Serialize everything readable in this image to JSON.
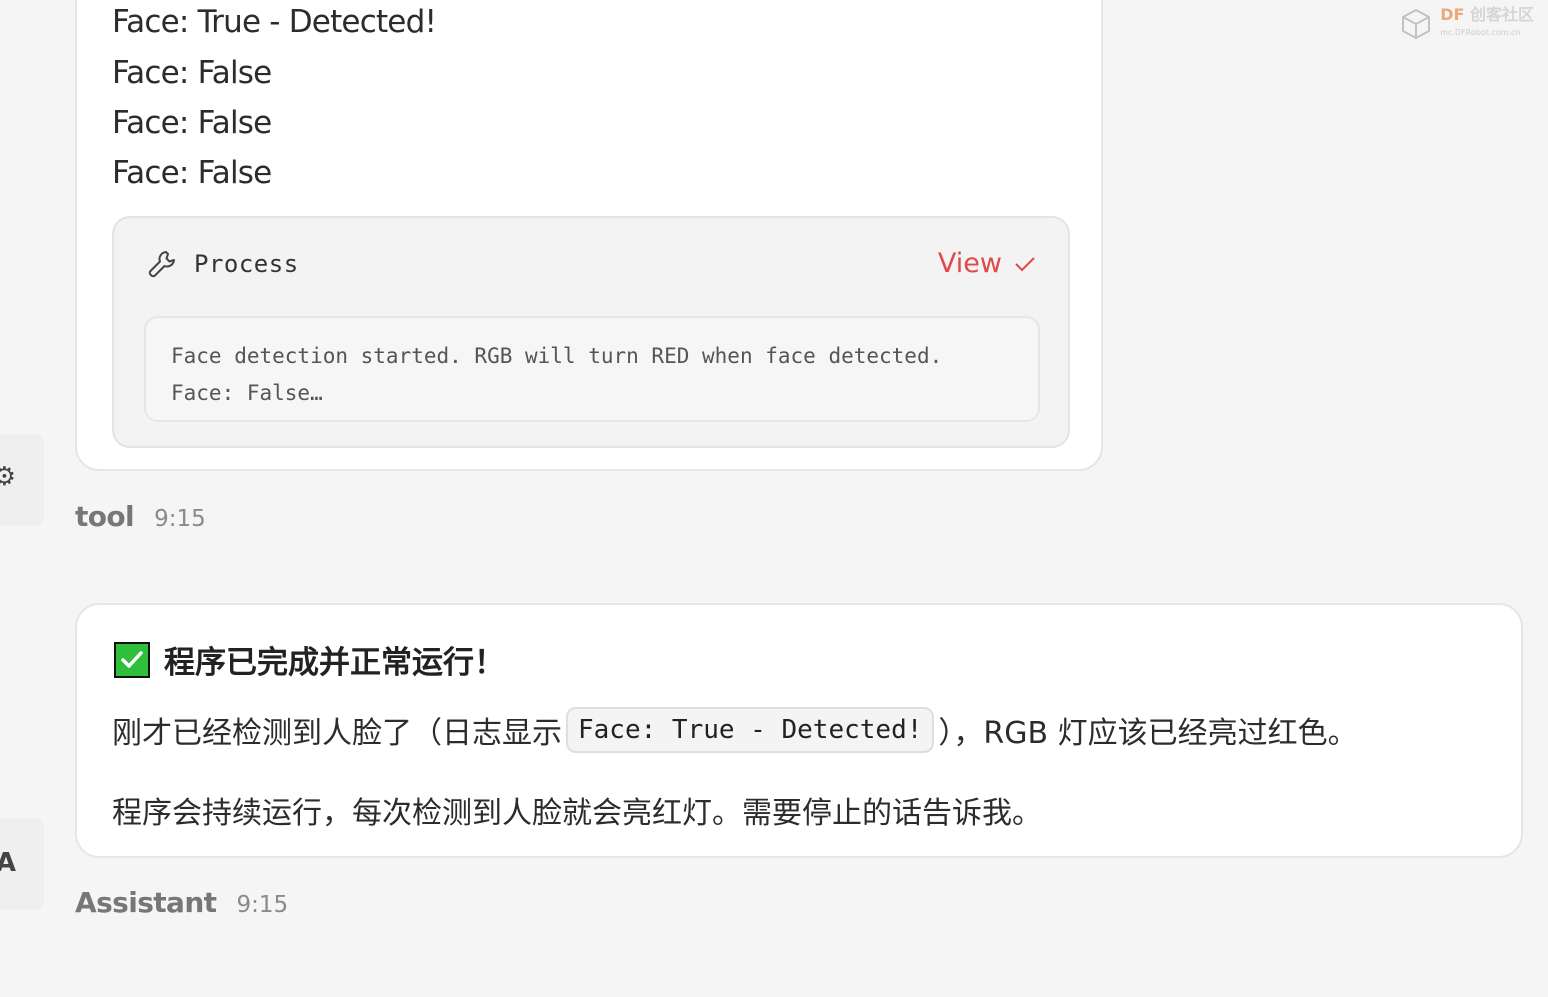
{
  "tool_message": {
    "log_lines": [
      "Face: True - Detected!",
      "Face: False",
      "Face: False",
      "Face: False"
    ],
    "process": {
      "title": "Process",
      "view_label": "View",
      "output_line1": "Face detection started. RGB will turn RED when face detected.",
      "output_line2": "Face: False…"
    },
    "sender": "tool",
    "time": "9:15"
  },
  "assistant_message": {
    "heading": "程序已完成并正常运行！",
    "para1_before": "刚才已经检测到人脸了（日志显示",
    "para1_code": "Face: True - Detected!",
    "para1_after": "），RGB 灯应该已经亮过红色。",
    "para2": "程序会持续运行，每次检测到人脸就会亮红灯。需要停止的话告诉我。",
    "sender": "Assistant",
    "time": "9:15"
  },
  "watermark": {
    "brand": "DF",
    "name": "创客社区",
    "sub": "mc.DFRobot.com.cn"
  },
  "colors": {
    "accent": "#e0484b",
    "check_green": "#2fbf3a"
  },
  "icons": {
    "process": "wrench-icon",
    "view": "chevron-check-icon",
    "heading": "check-mark-icon"
  }
}
